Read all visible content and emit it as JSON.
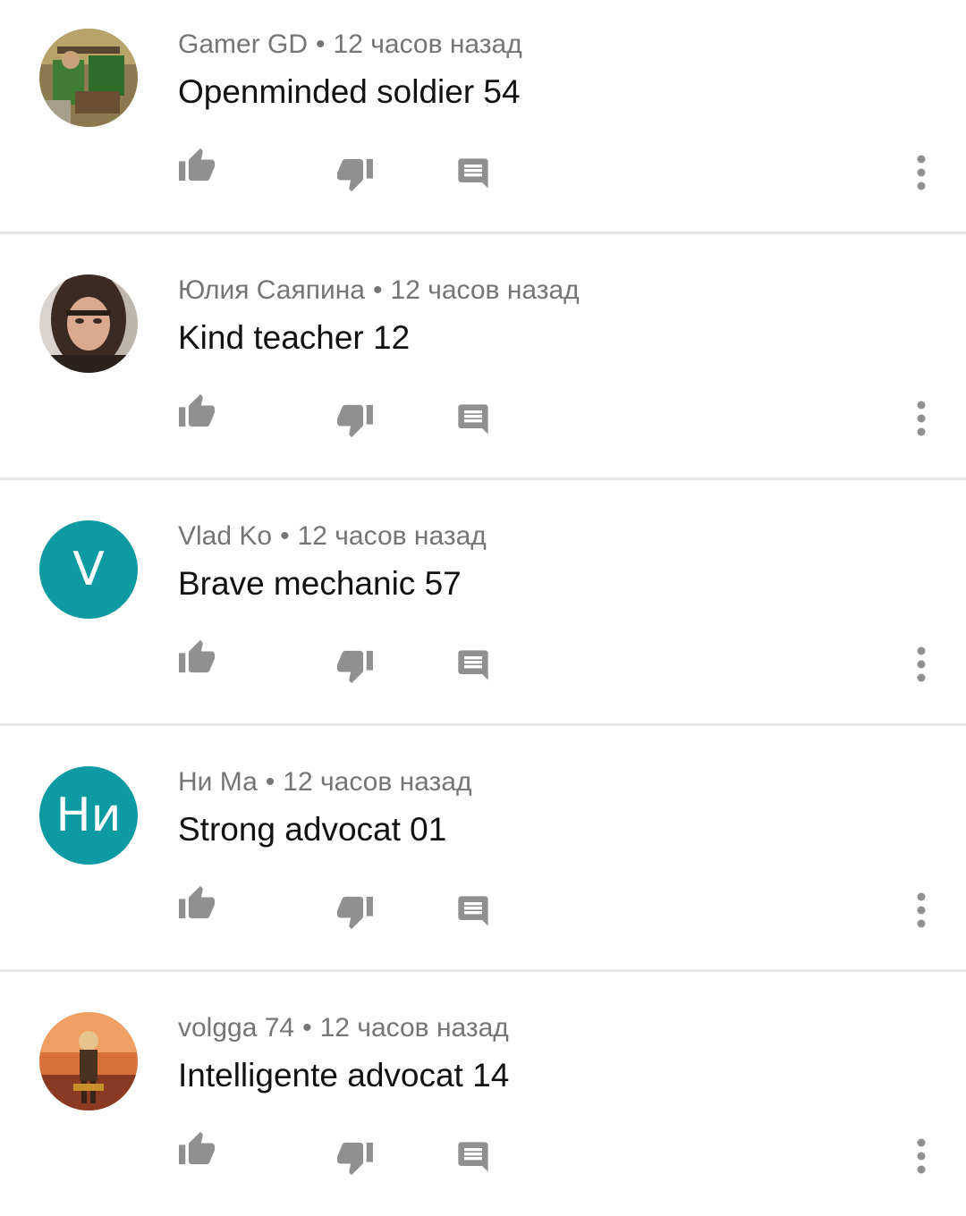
{
  "meta_separator": "•",
  "icons": {
    "like": "thumb-up-icon",
    "dislike": "thumb-down-icon",
    "reply": "reply-comment-icon",
    "more": "more-vert-icon"
  },
  "colors": {
    "icon_gray": "#909090",
    "meta_gray": "#757575",
    "text": "#111111",
    "letter_avatar": "#0d9aa2",
    "divider": "#e6e6e6"
  },
  "comments": [
    {
      "author": "Gamer GD",
      "time": "12 часов назад",
      "text": "Openminded soldier 54",
      "avatar": {
        "type": "image",
        "description": "soldier-game-art"
      }
    },
    {
      "author": "Юлия Саяпина",
      "time": "12 часов назад",
      "text": "Kind teacher 12",
      "avatar": {
        "type": "image",
        "description": "woman-portrait"
      }
    },
    {
      "author": "Vlad Ko",
      "time": "12 часов назад",
      "text": "Brave mechanic 57",
      "avatar": {
        "type": "letter",
        "letter": "V",
        "color": "#0d9aa2"
      }
    },
    {
      "author": "Ни Ма",
      "time": "12 часов назад",
      "text": "Strong advocat 01",
      "avatar": {
        "type": "letter",
        "letter": "Ни",
        "color": "#0d9aa2"
      }
    },
    {
      "author": "volgga 74",
      "time": "12 часов назад",
      "text": "Intelligente advocat 14",
      "avatar": {
        "type": "image",
        "description": "game-character-orange"
      }
    }
  ]
}
